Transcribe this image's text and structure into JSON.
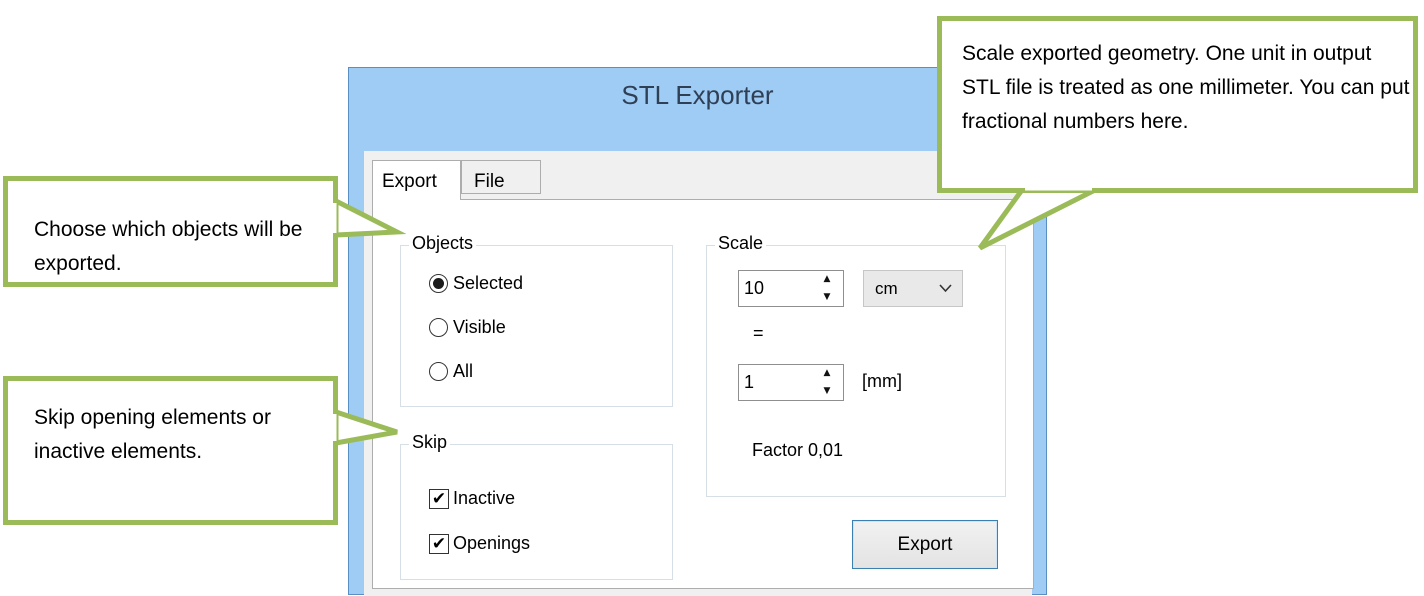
{
  "window": {
    "title": "STL Exporter",
    "tabs": [
      {
        "label": "Export",
        "active": true
      },
      {
        "label": "File",
        "active": false
      }
    ],
    "objects_group": {
      "legend": "Objects",
      "options": [
        {
          "label": "Selected",
          "selected": true
        },
        {
          "label": "Visible",
          "selected": false
        },
        {
          "label": "All",
          "selected": false
        }
      ]
    },
    "skip_group": {
      "legend": "Skip",
      "options": [
        {
          "label": "Inactive",
          "checked": true
        },
        {
          "label": "Openings",
          "checked": true
        }
      ]
    },
    "scale_group": {
      "legend": "Scale",
      "scale_value": "10",
      "unit_selected": "cm",
      "equals": "=",
      "mm_value": "1",
      "mm_label": "[mm]",
      "factor_text": "Factor 0,01"
    },
    "export_button": "Export"
  },
  "callouts": {
    "objects": "Choose which objects will be exported.",
    "skip": "Skip opening elements or inactive elements.",
    "scale": "Scale exported geometry. One unit in output STL file is treated as one millimeter. You can put fractional numbers here."
  },
  "colors": {
    "callout_border": "#9bbb59",
    "title_bar": "#9fccf5",
    "window_border": "#5a8fc3"
  },
  "icons": {
    "spin_up": "up-triangle",
    "spin_down": "down-triangle",
    "dropdown": "chevron-down",
    "check": "checkmark"
  }
}
